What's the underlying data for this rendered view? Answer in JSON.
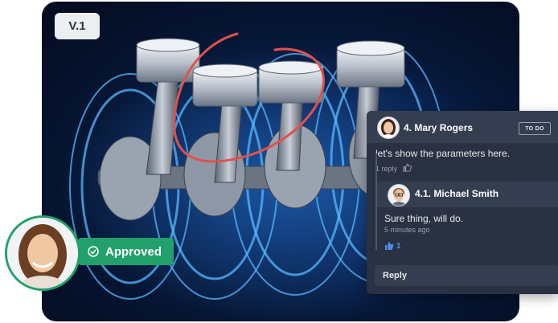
{
  "version_label": "V.1",
  "approved": {
    "label": "Approved",
    "color": "#22a06b"
  },
  "comment": {
    "author": "4. Mary Rogers",
    "status": "TO DO",
    "text": "let's show the parameters here.",
    "meta": "1 reply",
    "reply": {
      "author": "4.1. Michael Smith",
      "text": "Sure thing, will do.",
      "time": "5 minutes ago",
      "likes": "1"
    },
    "reply_button": "Reply"
  },
  "icons": [
    "check-circle-icon",
    "thumbs-up-icon"
  ],
  "colors": {
    "accent_green": "#22a06b",
    "like_blue": "#4b8fe8",
    "annotation_red": "#e2514a"
  }
}
